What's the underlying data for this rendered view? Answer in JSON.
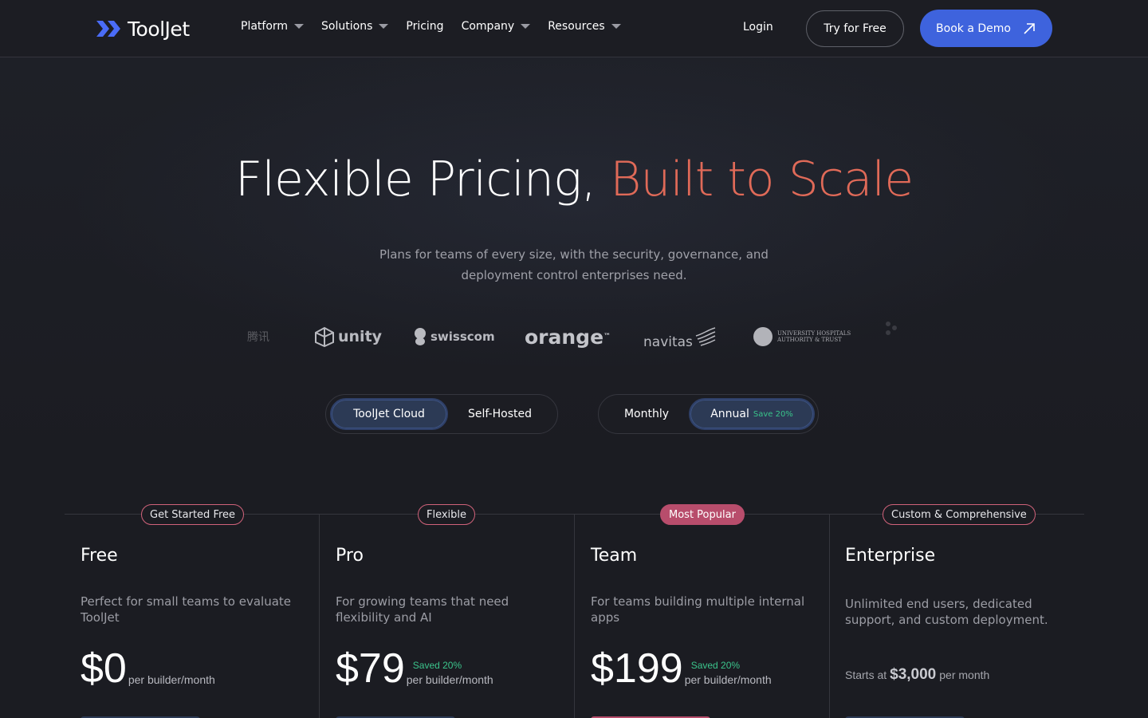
{
  "nav": {
    "logo_text": "ToolJet",
    "menu": [
      {
        "label": "Platform",
        "dropdown": true
      },
      {
        "label": "Solutions",
        "dropdown": true
      },
      {
        "label": "Pricing",
        "dropdown": false
      },
      {
        "label": "Company",
        "dropdown": true
      },
      {
        "label": "Resources",
        "dropdown": true
      }
    ],
    "login": "Login",
    "try_free": "Try for Free",
    "book_demo": "Book a Demo"
  },
  "hero": {
    "title_main": "Flexible Pricing, ",
    "title_accent": "Built to Scale",
    "subtitle": "Plans for teams of every size, with the security, governance, and deployment control enterprises need."
  },
  "customer_logos": {
    "tencent": "腾讯",
    "unity": "unity",
    "swisscom": "swisscom",
    "orange": "orange",
    "orange_tm": "™",
    "navitas": "navitas",
    "uh_line1": "UNIVERSITY HOSPITALS",
    "uh_line2": "AUTHORITY & TRUST"
  },
  "toggles": {
    "hosting": {
      "cloud": "ToolJet Cloud",
      "self": "Self-Hosted",
      "selected": "ToolJet Cloud"
    },
    "billing": {
      "monthly": "Monthly",
      "annual": "Annual",
      "annual_save": "Save 20%",
      "selected": "Annual"
    }
  },
  "plans": [
    {
      "badge": "Get Started Free",
      "name": "Free",
      "desc": "Perfect for small teams to evaluate ToolJet",
      "price": "$0",
      "saved": "",
      "unit": "per builder/month"
    },
    {
      "badge": "Flexible",
      "name": "Pro",
      "desc": "For growing teams that need flexibility and AI",
      "price": "$79",
      "saved": "Saved 20%",
      "unit": "per builder/month"
    },
    {
      "badge": "Most Popular",
      "name": "Team",
      "desc": "For teams building multiple internal apps",
      "price": "$199",
      "saved": "Saved 20%",
      "unit": "per builder/month"
    },
    {
      "badge": "Custom & Comprehensive",
      "name": "Enterprise",
      "desc": "Unlimited end users, dedicated support, and custom deployment.",
      "starts_at": "Starts at",
      "price": "$3,000",
      "unit": "per month"
    }
  ],
  "colors": {
    "accent": "#e06a58",
    "primary": "#3e63dd",
    "success": "#3bc48c",
    "badge_border": "#d0627a",
    "popular": "#b84d6c"
  }
}
